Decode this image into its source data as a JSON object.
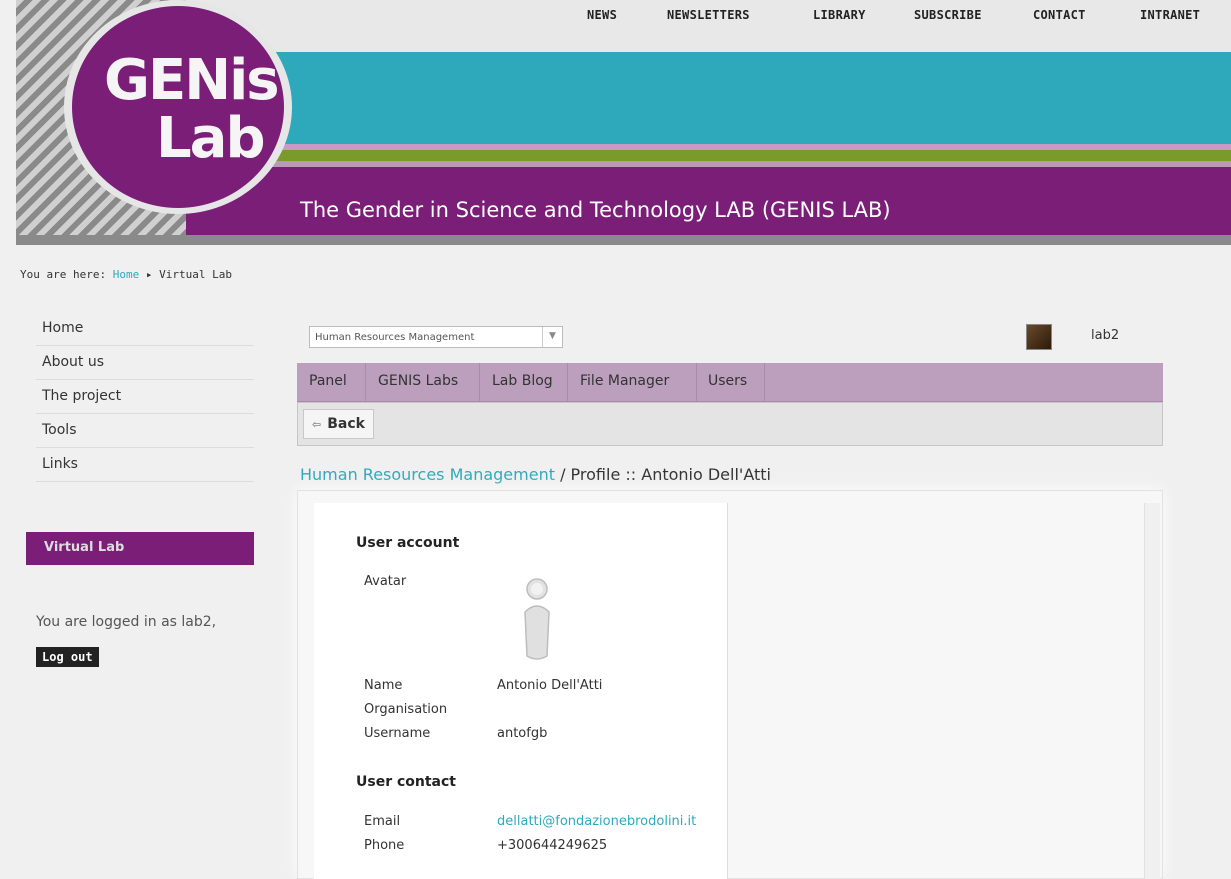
{
  "topnav": [
    "NEWS",
    "NEWSLETTERS",
    "LIBRARY",
    "SUBSCRIBE",
    "CONTACT",
    "INTRANET"
  ],
  "logo": {
    "line1": "GENis",
    "line2": "Lab"
  },
  "site_title": "The Gender in Science and Technology LAB (GENIS LAB)",
  "breadcrumb": {
    "prefix": "You are here:",
    "home": "Home",
    "separator": "▸",
    "current": "Virtual Lab"
  },
  "sidebar": {
    "items": [
      "Home",
      "About us",
      "The project",
      "Tools",
      "Links"
    ],
    "section": "Virtual Lab",
    "logged_text": "You are logged in as lab2,",
    "logout_label": "Log out"
  },
  "selector": {
    "value": "Human Resources Management"
  },
  "user": {
    "name": "lab2"
  },
  "tabs": [
    "Panel",
    "GENIS Labs",
    "Lab Blog",
    "File Manager",
    "Users"
  ],
  "toolbar": {
    "back_label": "Back"
  },
  "heading": {
    "link": "Human Resources Management",
    "rest": " / Profile :: Antonio Dell'Atti"
  },
  "profile": {
    "account_title": "User account",
    "avatar_label": "Avatar",
    "name_label": "Name",
    "name_value": "Antonio Dell'Atti",
    "org_label": "Organisation",
    "org_value": "",
    "username_label": "Username",
    "username_value": "antofgb",
    "contact_title": "User contact",
    "email_label": "Email",
    "email_value": "dellatti@fondazionebrodolini.it",
    "phone_label": "Phone",
    "phone_value": "+300644249625"
  },
  "colors": {
    "purple": "#7a1e78",
    "teal": "#2ea9bb",
    "tabs_bg": "#bb9fbd",
    "green": "#7a9a2a"
  }
}
